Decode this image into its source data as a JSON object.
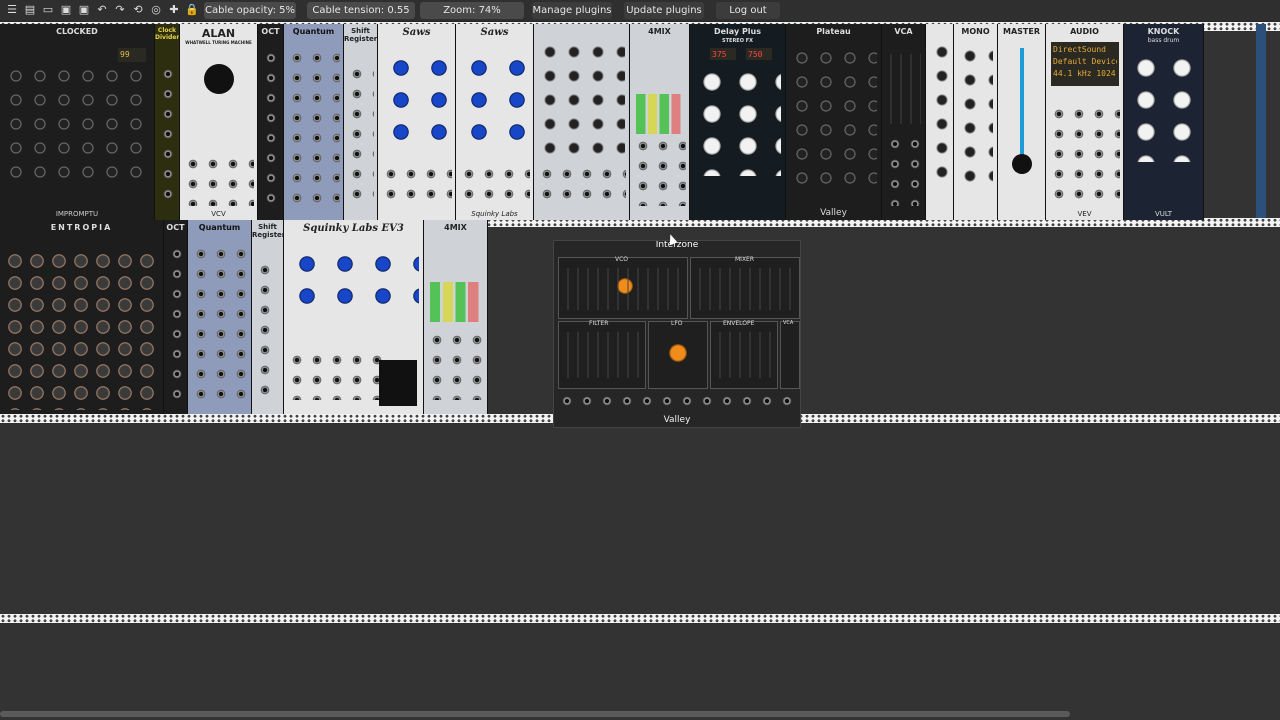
{
  "toolbar": {
    "icons": [
      "menu-icon",
      "file-icon",
      "folder-icon",
      "save-icon",
      "save-as-icon",
      "undo-icon",
      "redo-icon",
      "cpu-icon",
      "library-icon",
      "plugin-icon",
      "lock-icon"
    ],
    "cable_opacity": "Cable opacity: 5%",
    "cable_tension": "Cable tension: 0.55",
    "zoom": "Zoom: 74%",
    "manage_plugins": "Manage plugins",
    "update_plugins": "Update plugins",
    "log_out": "Log out"
  },
  "modules": {
    "clocked": "CLOCKED",
    "clocked_brand": "IMPROMPTU",
    "clocked_bpm": "99",
    "clock_divider": "Clock Divider",
    "alan": "ALAN",
    "alan_sub": "WHATWELL TURING MACHINE",
    "alan_brand": "VCV",
    "oct_top": "OCT",
    "quantum_top": "Quantum",
    "shift_register_top": "Shift Register",
    "saws_a": "Saws",
    "saws_b": "Saws",
    "squinky": "Squinky Labs",
    "mix_top": "4MIX",
    "delay_plus": "Delay Plus",
    "delay_stereo": "STEREO FX",
    "delay_display_left": "375",
    "delay_display_right": "750",
    "plateau": "Plateau",
    "plateau_brand": "Valley",
    "vca": "VCA",
    "mono": "MONO",
    "master": "MASTER",
    "audio": "AUDIO",
    "audio_device": "DirectSound",
    "audio_driver": "Default Device (1-2 out)",
    "audio_rate": "44.1 kHz  1024",
    "audio_brand": "VEV",
    "knock": "KNOCK",
    "knock_sub": "bass drum",
    "knock_brand": "VULT",
    "entropia": "ENTROPIA",
    "oct_bottom": "OCT",
    "quantum_bottom": "Quantum",
    "shift_register_bottom": "Shift Register",
    "squinky_evo": "Squinky Labs EV3",
    "mix_bottom": "4MIX",
    "interzone": "Interzone",
    "interzone_brand": "Valley",
    "interzone_sections": [
      "VCO",
      "MIXER",
      "FILTER",
      "LFO",
      "ENVELOPE",
      "VCA"
    ],
    "interzone_labels": [
      "Semi",
      "Octave",
      "Coarse",
      "Fine",
      "Width",
      "PWM",
      "Slide",
      "Mod",
      "Pink",
      "White",
      "Noise Ext",
      "Freq",
      "Res",
      "HPF",
      "Env",
      "LFO",
      "Rate",
      "Fine",
      "Wave",
      "Long",
      "Short",
      "Cycle",
      "Gate",
      "Level"
    ]
  }
}
